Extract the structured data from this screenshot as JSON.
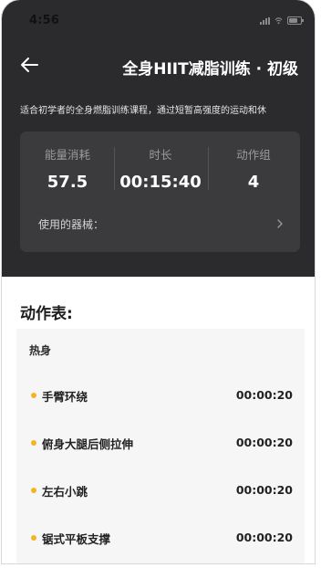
{
  "status_bar": {
    "time": "4:56"
  },
  "header": {
    "title": "全身HIIT减脂训练 · 初级",
    "description": "适合初学者的全身燃脂训练课程，通过短暂高强度的运动和休"
  },
  "stats": [
    {
      "label": "能量消耗",
      "value": "57.5"
    },
    {
      "label": "时长",
      "value": "00:15:40"
    },
    {
      "label": "动作组",
      "value": "4"
    }
  ],
  "equipment": {
    "label": "使用的器械："
  },
  "exercise_table": {
    "title": "动作表:",
    "group_title": "热身",
    "items": [
      {
        "name": "手臂环绕",
        "duration": "00:00:20"
      },
      {
        "name": "俯身大腿后侧拉伸",
        "duration": "00:00:20"
      },
      {
        "name": "左右小跳",
        "duration": "00:00:20"
      },
      {
        "name": "锯式平板支撑",
        "duration": "00:00:20"
      }
    ]
  },
  "colors": {
    "header_bg": "#2b2b2e",
    "card_bg": "#3b3b3e",
    "accent_dot": "#f4b325",
    "list_bg": "#f6f6f6"
  },
  "icons": {
    "back": "arrow-left-icon",
    "chevron": "chevron-right-icon",
    "signal": "signal-icon",
    "wifi": "wifi-icon",
    "battery": "battery-icon"
  }
}
